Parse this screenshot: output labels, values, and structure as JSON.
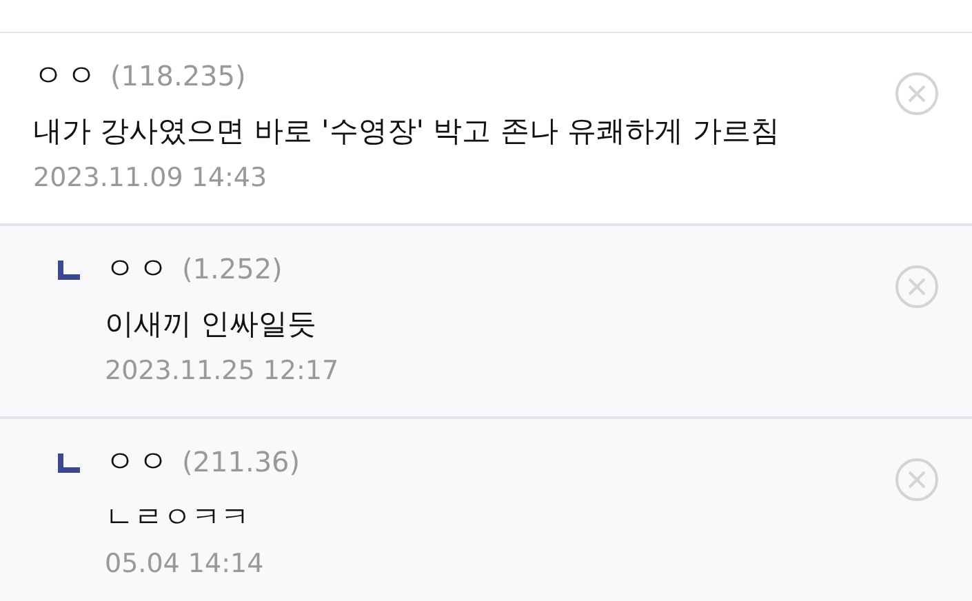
{
  "comments": [
    {
      "nickname": "ㅇㅇ",
      "ip": "(118.235)",
      "text": "내가 강사였으면 바로 '수영장' 박고 존나 유쾌하게 가르침",
      "date": "2023.11.09 14:43",
      "children": [
        {
          "nickname": "ㅇㅇ",
          "ip": "(1.252)",
          "text": "이새끼 인싸일듯",
          "date": "2023.11.25 12:17"
        },
        {
          "nickname": "ㅇㅇ",
          "ip": "(211.36)",
          "text": "ㄴㄹㅇㅋㅋ",
          "date": "05.04 14:14"
        }
      ]
    }
  ]
}
